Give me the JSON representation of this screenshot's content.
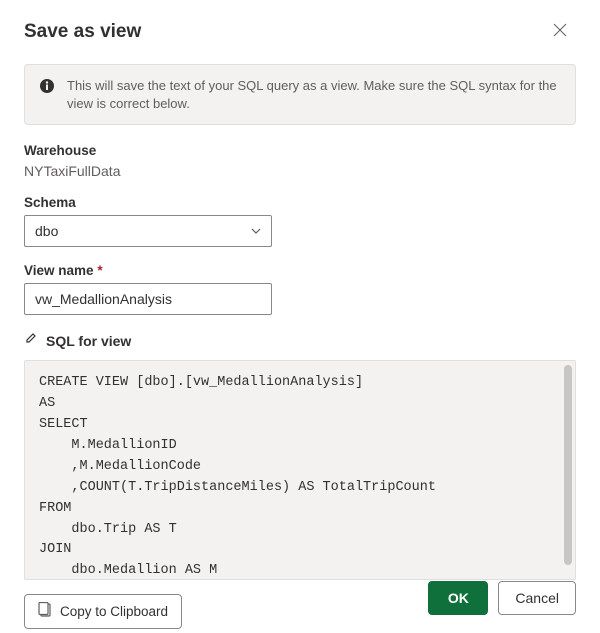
{
  "dialog": {
    "title": "Save as view",
    "info_text": "This will save the text of your SQL query as a view. Make sure the SQL syntax for the view is correct below."
  },
  "warehouse": {
    "label": "Warehouse",
    "value": "NYTaxiFullData"
  },
  "schema": {
    "label": "Schema",
    "selected": "dbo"
  },
  "view_name": {
    "label": "View name",
    "required_mark": "*",
    "value": "vw_MedallionAnalysis"
  },
  "sql_section": {
    "title": "SQL for view",
    "code": "CREATE VIEW [dbo].[vw_MedallionAnalysis]\nAS\nSELECT\n    M.MedallionID\n    ,M.MedallionCode\n    ,COUNT(T.TripDistanceMiles) AS TotalTripCount\nFROM\n    dbo.Trip AS T\nJOIN\n    dbo.Medallion AS M"
  },
  "buttons": {
    "copy": "Copy to Clipboard",
    "ok": "OK",
    "cancel": "Cancel"
  }
}
